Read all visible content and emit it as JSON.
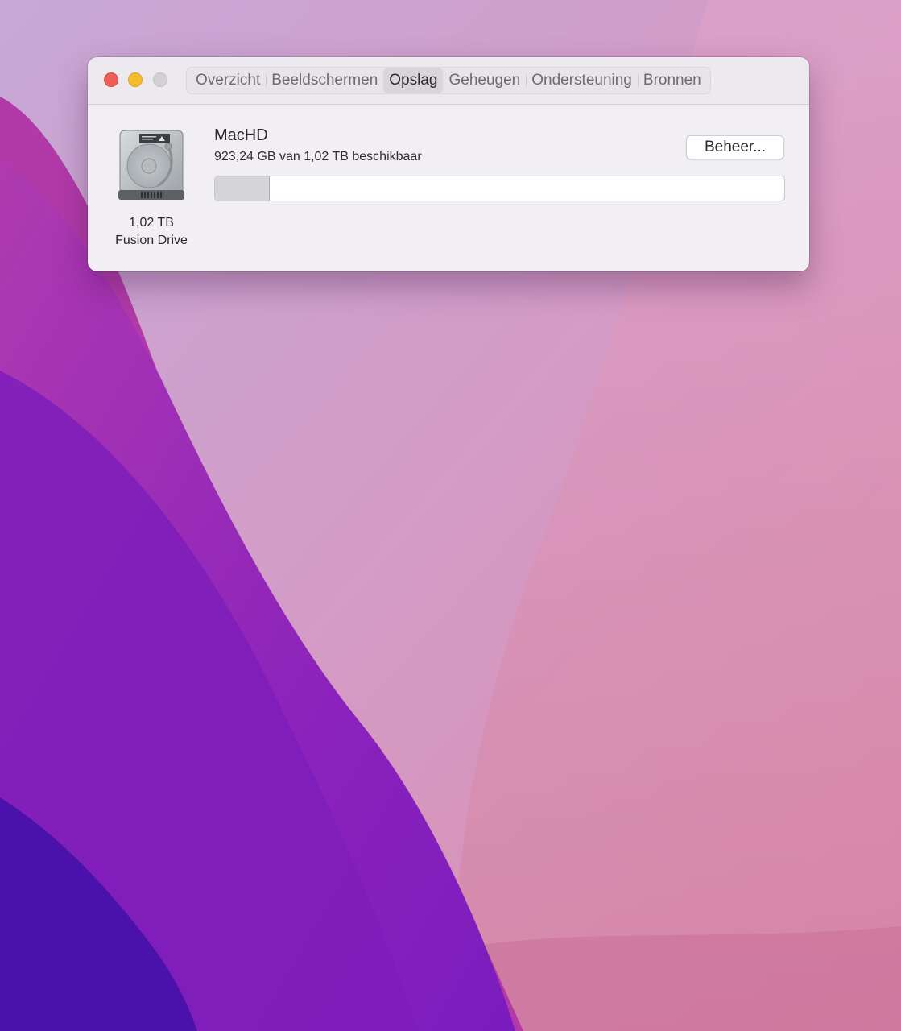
{
  "window": {
    "tabs": [
      {
        "label": "Overzicht",
        "active": false
      },
      {
        "label": "Beeldschermen",
        "active": false
      },
      {
        "label": "Opslag",
        "active": true
      },
      {
        "label": "Geheugen",
        "active": false
      },
      {
        "label": "Ondersteuning",
        "active": false
      },
      {
        "label": "Bronnen",
        "active": false
      }
    ]
  },
  "drive": {
    "icon": "hard-drive-icon",
    "capacity": "1,02 TB",
    "type": "Fusion Drive"
  },
  "volume": {
    "name": "MacHD",
    "availability": "923,24 GB van 1,02 TB beschikbaar",
    "used_fraction": 0.095,
    "manage_label": "Beheer..."
  },
  "colors": {
    "close": "#ee5d56",
    "minimize": "#f5bc2f",
    "zoom": "#d3d1d5",
    "wallpaper_purple": "#8a22b8",
    "wallpaper_pink": "#d99ac0"
  }
}
